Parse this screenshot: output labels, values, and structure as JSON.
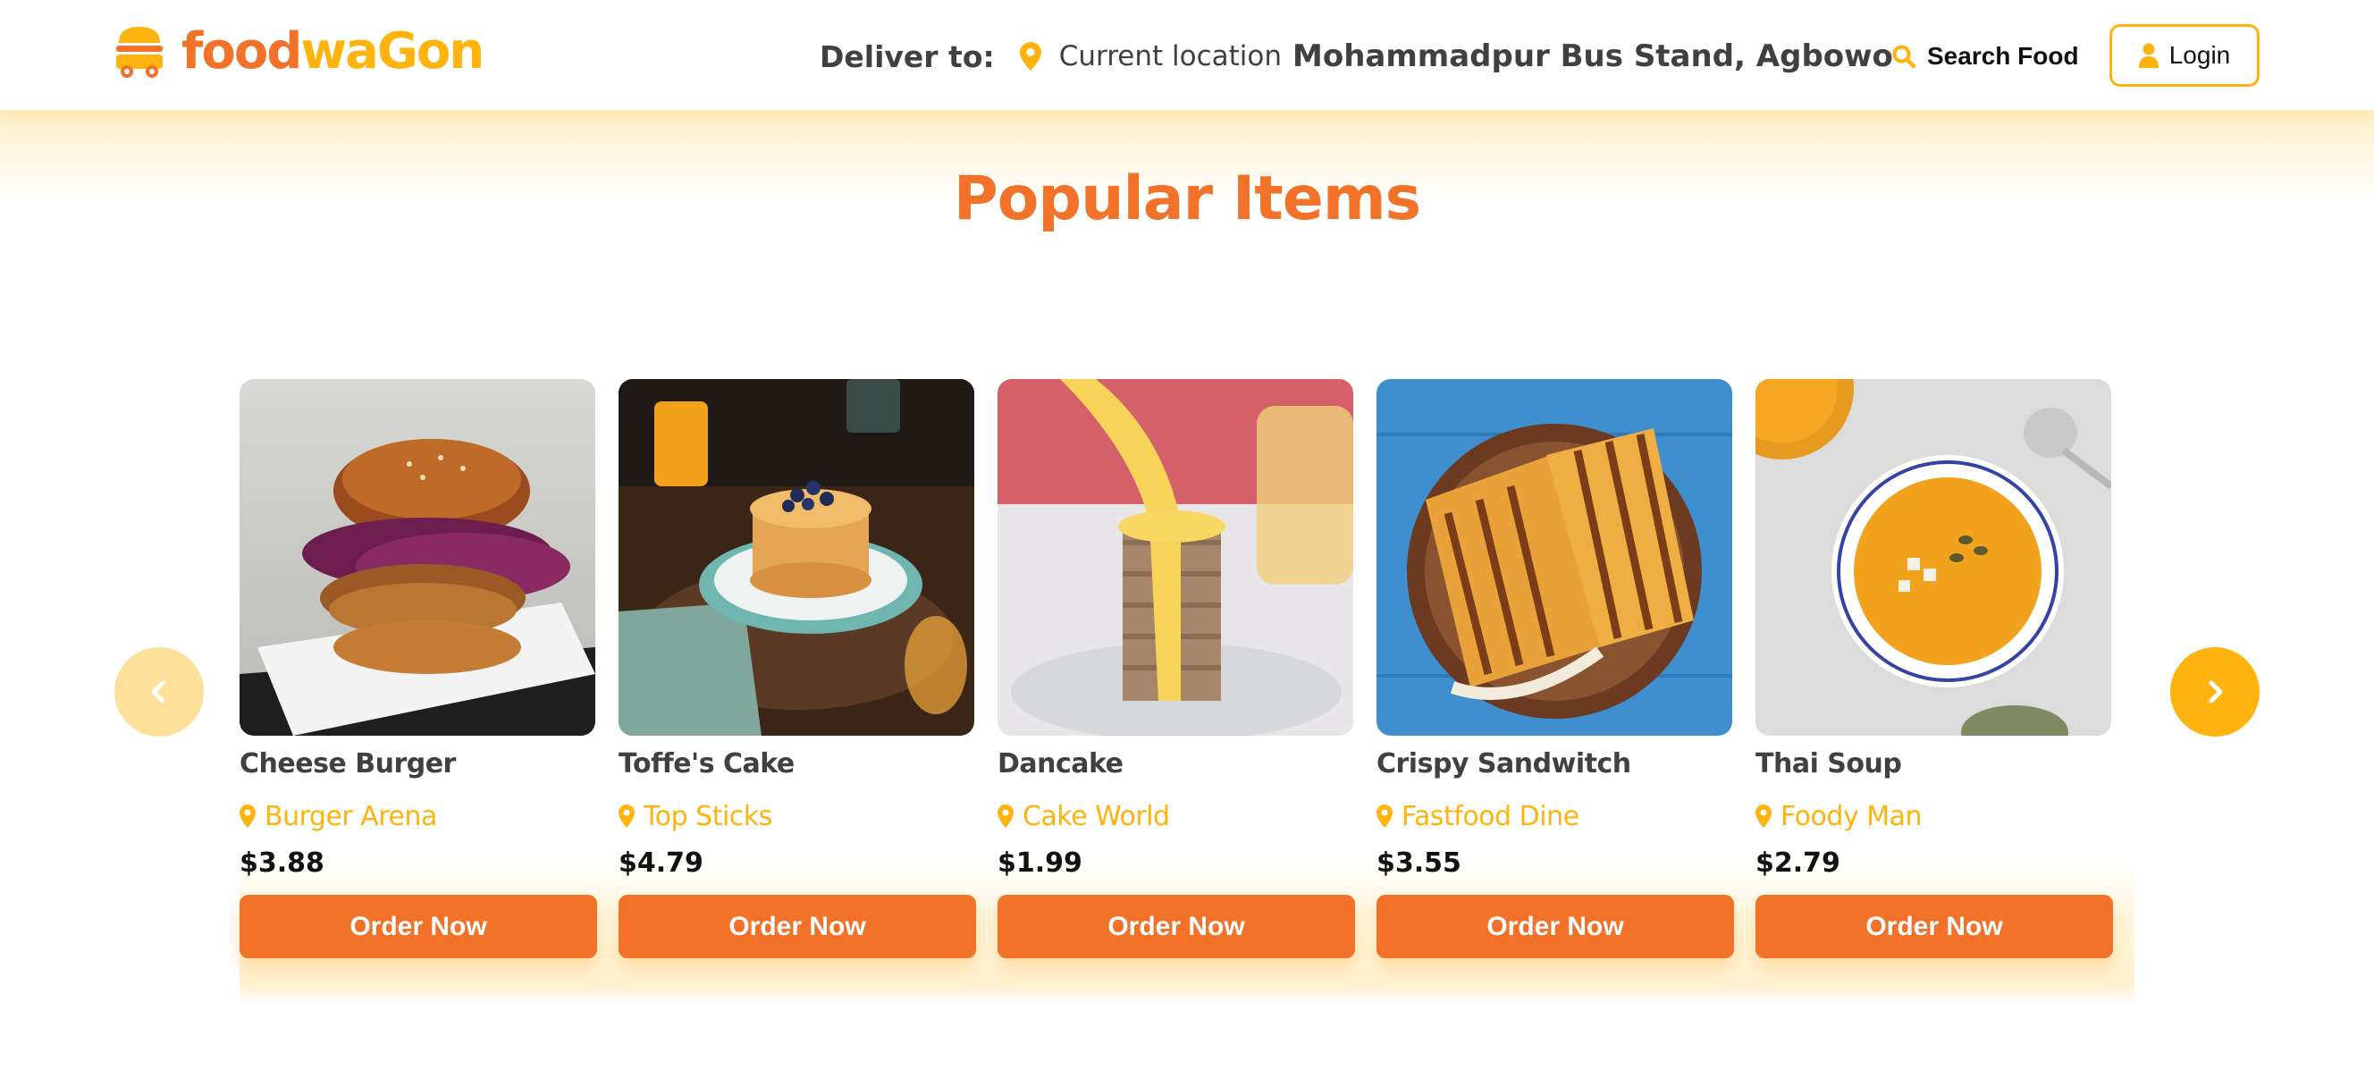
{
  "brand": {
    "part1": "food",
    "part2": "waGon",
    "primary_color": "#F17228",
    "accent_color": "#FFB30E"
  },
  "header": {
    "deliver_label": "Deliver to:",
    "current_location": "Current location",
    "address": "Mohammadpur Bus Stand, Agbowo",
    "search_label": "Search Food",
    "login_label": "Login"
  },
  "section": {
    "title": "Popular Items"
  },
  "carousel": {
    "prev_icon": "chevron-left-icon",
    "next_icon": "chevron-right-icon",
    "items": [
      {
        "name": "Cheese Burger",
        "restaurant": "Burger Arena",
        "price": "$3.88",
        "button": "Order Now",
        "image": "cheese-burger-photo"
      },
      {
        "name": "Toffe's Cake",
        "restaurant": "Top Sticks",
        "price": "$4.79",
        "button": "Order Now",
        "image": "pancake-stack-photo"
      },
      {
        "name": "Dancake",
        "restaurant": "Cake World",
        "price": "$1.99",
        "button": "Order Now",
        "image": "dancake-photo"
      },
      {
        "name": "Crispy Sandwitch",
        "restaurant": "Fastfood Dine",
        "price": "$3.55",
        "button": "Order Now",
        "image": "sandwich-photo"
      },
      {
        "name": "Thai Soup",
        "restaurant": "Foody Man",
        "price": "$2.79",
        "button": "Order Now",
        "image": "soup-photo"
      }
    ]
  }
}
